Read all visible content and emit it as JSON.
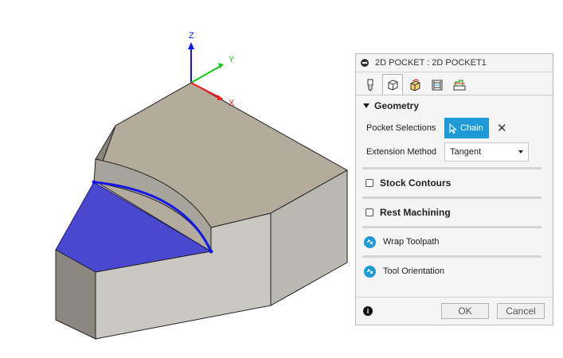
{
  "viewport": {
    "axis_z": "Z",
    "axis_y": "Y",
    "axis_x": "X",
    "selection_color": "#3f3fd0",
    "chain_color": "#1515e8"
  },
  "dialog": {
    "title": "2D POCKET : 2D POCKET1",
    "tabs": [
      {
        "icon": "tool-icon"
      },
      {
        "icon": "geometry-icon"
      },
      {
        "icon": "heights-icon"
      },
      {
        "icon": "passes-icon"
      },
      {
        "icon": "linking-icon"
      }
    ],
    "geometry": {
      "title": "Geometry",
      "pocket_selections_label": "Pocket Selections",
      "chain_button_label": "Chain",
      "clear_symbol": "✕",
      "extension_method_label": "Extension Method",
      "extension_method_value": "Tangent"
    },
    "stock_contours": {
      "label": "Stock Contours"
    },
    "rest_machining": {
      "label": "Rest Machining"
    },
    "wrap_toolpath": {
      "label": "Wrap Toolpath"
    },
    "tool_orientation": {
      "label": "Tool Orientation"
    },
    "footer": {
      "info_symbol": "i",
      "ok_label": "OK",
      "cancel_label": "Cancel"
    },
    "accent_color": "#1e9bd7"
  }
}
